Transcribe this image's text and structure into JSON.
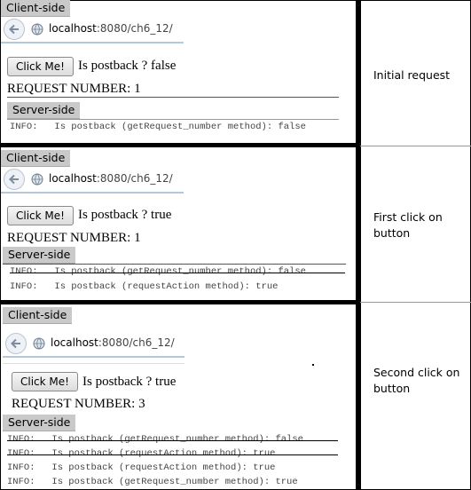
{
  "panels": [
    {
      "client_label": "Client-side",
      "url_host": "localhost",
      "url_rest": ":8080/ch6_12/",
      "button_label": "Click Me!",
      "postback_text": "Is postback ? false",
      "request_number": "REQUEST NUMBER: 1",
      "server_label": "Server-side",
      "logs": [
        "INFO:   Is postback (getRequest_number method): false"
      ],
      "caption": "Initial request"
    },
    {
      "client_label": "Client-side",
      "url_host": "localhost",
      "url_rest": ":8080/ch6_12/",
      "button_label": "Click Me!",
      "postback_text": "Is postback ? true",
      "request_number": "REQUEST NUMBER: 1",
      "server_label": "Server-side",
      "logs": [
        "INFO:   Is postback (getRequest_number method): false",
        "INFO:   Is postback (requestAction method): true"
      ],
      "caption": "First click on button"
    },
    {
      "client_label": "Client-side",
      "url_host": "localhost",
      "url_rest": ":8080/ch6_12/",
      "button_label": "Click Me!",
      "postback_text": "Is postback ? true",
      "request_number": "REQUEST NUMBER: 3",
      "server_label": "Server-side",
      "logs": [
        "INFO:   Is postback (getRequest_number method): false",
        "INFO:   Is postback (requestAction method): true",
        "INFO:   Is postback (requestAction method): true",
        "INFO:   Is postback (getRequest_number method): true"
      ],
      "caption": "Second click on button"
    }
  ],
  "colors": {
    "tag_bg": "#c9c9c9",
    "urlbar_border": "#b4c8dc",
    "separator": "#000000"
  }
}
